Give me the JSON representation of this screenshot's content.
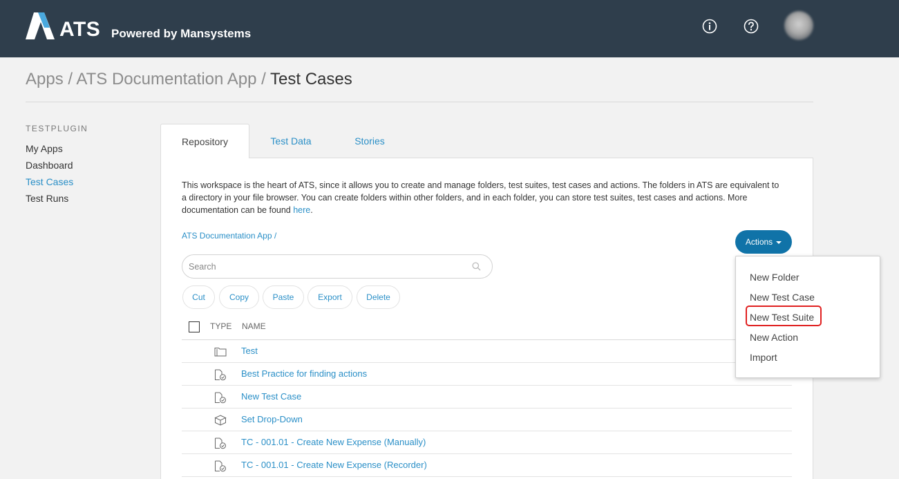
{
  "brand": {
    "name": "ATS",
    "tagline": "Powered by Mansystems"
  },
  "header": {
    "icons": [
      "info-icon",
      "help-icon"
    ]
  },
  "breadcrumb": {
    "part1": "Apps",
    "sep": "/",
    "part2": "ATS Documentation App",
    "current": "Test Cases"
  },
  "sidebar": {
    "heading": "TESTPLUGIN",
    "items": [
      {
        "label": "My Apps",
        "active": false
      },
      {
        "label": "Dashboard",
        "active": false
      },
      {
        "label": "Test Cases",
        "active": true
      },
      {
        "label": "Test Runs",
        "active": false
      }
    ]
  },
  "tabs": [
    {
      "label": "Repository",
      "active": true
    },
    {
      "label": "Test Data",
      "active": false
    },
    {
      "label": "Stories",
      "active": false
    }
  ],
  "description": {
    "text": "This workspace is the heart of ATS, since it allows you to create and manage folders, test suites, test cases and actions. The folders in ATS are equivalent to a directory in your file browser. You can create folders within other folders, and in each folder, you can store test suites, test cases and actions. More documentation can be found ",
    "link": "here",
    "end": "."
  },
  "path": "ATS Documentation App /",
  "actions": {
    "label": "Actions",
    "menu": [
      "New Folder",
      "New Test Case",
      "New Test Suite",
      "New Action",
      "Import"
    ],
    "highlighted": "New Test Suite"
  },
  "search": {
    "placeholder": "Search",
    "value": ""
  },
  "toolbar": {
    "cut": "Cut",
    "copy": "Copy",
    "paste": "Paste",
    "export": "Export",
    "delete": "Delete"
  },
  "table": {
    "columns": [
      "TYPE",
      "NAME"
    ],
    "rows": [
      {
        "type": "folder-icon",
        "name": "Test"
      },
      {
        "type": "test-case-icon",
        "name": "Best Practice for finding actions"
      },
      {
        "type": "test-case-icon",
        "name": "New Test Case"
      },
      {
        "type": "action-icon",
        "name": "Set Drop-Down"
      },
      {
        "type": "test-case-icon",
        "name": "TC - 001.01 - Create New Expense (Manually)"
      },
      {
        "type": "test-case-icon",
        "name": "TC - 001.01 - Create New Expense (Recorder)"
      }
    ]
  },
  "colors": {
    "header_bg": "#2f3e4c",
    "link": "#2a8fc7",
    "primary_button": "#1073a8",
    "highlight": "#e02020"
  }
}
